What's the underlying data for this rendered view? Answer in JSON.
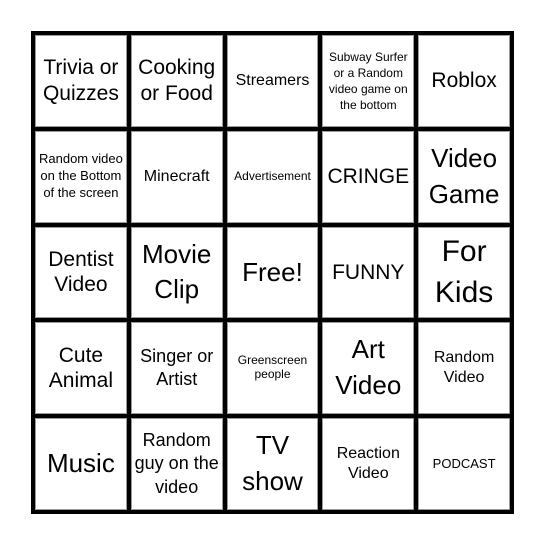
{
  "board": {
    "cells": [
      {
        "text": "Trivia or Quizzes",
        "size": "s-lg"
      },
      {
        "text": "Cooking or Food",
        "size": "s-lg"
      },
      {
        "text": "Streamers",
        "size": "s-md"
      },
      {
        "text": "Subway Surfer or a Random video game on the bottom",
        "size": "tight"
      },
      {
        "text": "Roblox",
        "size": "s-lg"
      },
      {
        "text": "Random video on the Bottom of the screen",
        "size": "s-sm"
      },
      {
        "text": "Minecraft",
        "size": "s-md"
      },
      {
        "text": "Advertisement",
        "size": "s-xs"
      },
      {
        "text": "CRINGE",
        "size": "s-lg"
      },
      {
        "text": "Video Game",
        "size": "s-xl"
      },
      {
        "text": "Dentist Video",
        "size": "s-lg"
      },
      {
        "text": "Movie Clip",
        "size": "s-xl"
      },
      {
        "text": "Free!",
        "size": "s-xl"
      },
      {
        "text": "FUNNY",
        "size": "s-lg"
      },
      {
        "text": "For Kids",
        "size": "s-xxl"
      },
      {
        "text": "Cute Animal",
        "size": "s-lg"
      },
      {
        "text": "Singer or Artist",
        "size": "s-ml"
      },
      {
        "text": "Greenscreen people",
        "size": "s-xs"
      },
      {
        "text": "Art Video",
        "size": "s-xl"
      },
      {
        "text": "Random Video",
        "size": "s-md"
      },
      {
        "text": "Music",
        "size": "s-xl"
      },
      {
        "text": "Random guy on the video",
        "size": "s-ml"
      },
      {
        "text": "TV show",
        "size": "s-xl"
      },
      {
        "text": "Reaction Video",
        "size": "s-md"
      },
      {
        "text": "PODCAST",
        "size": "s-sm"
      }
    ]
  }
}
